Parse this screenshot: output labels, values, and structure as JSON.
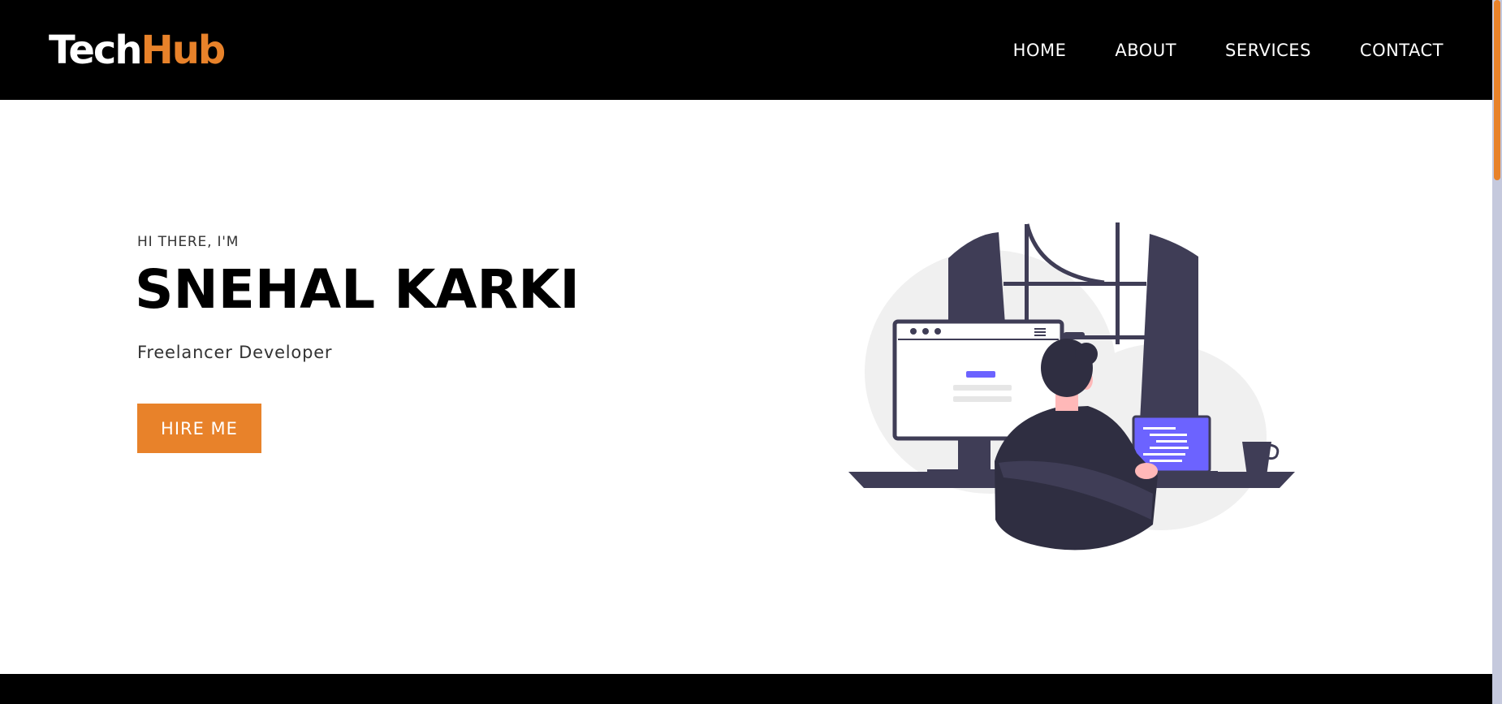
{
  "brand": {
    "part1": "Tech",
    "part2": "Hub"
  },
  "nav": {
    "items": [
      "HOME",
      "ABOUT",
      "SERVICES",
      "CONTACT"
    ]
  },
  "hero": {
    "greeting": "HI THERE, I'M",
    "name": "SNEHAL KARKI",
    "role": "Freelancer Developer",
    "cta": "HIRE ME"
  },
  "colors": {
    "accent": "#e8822a",
    "dark": "#000000",
    "illustration_dark": "#3f3d56",
    "illustration_purple": "#6c63ff"
  },
  "icons": {
    "illustration": "developer-at-desk-illustration"
  }
}
